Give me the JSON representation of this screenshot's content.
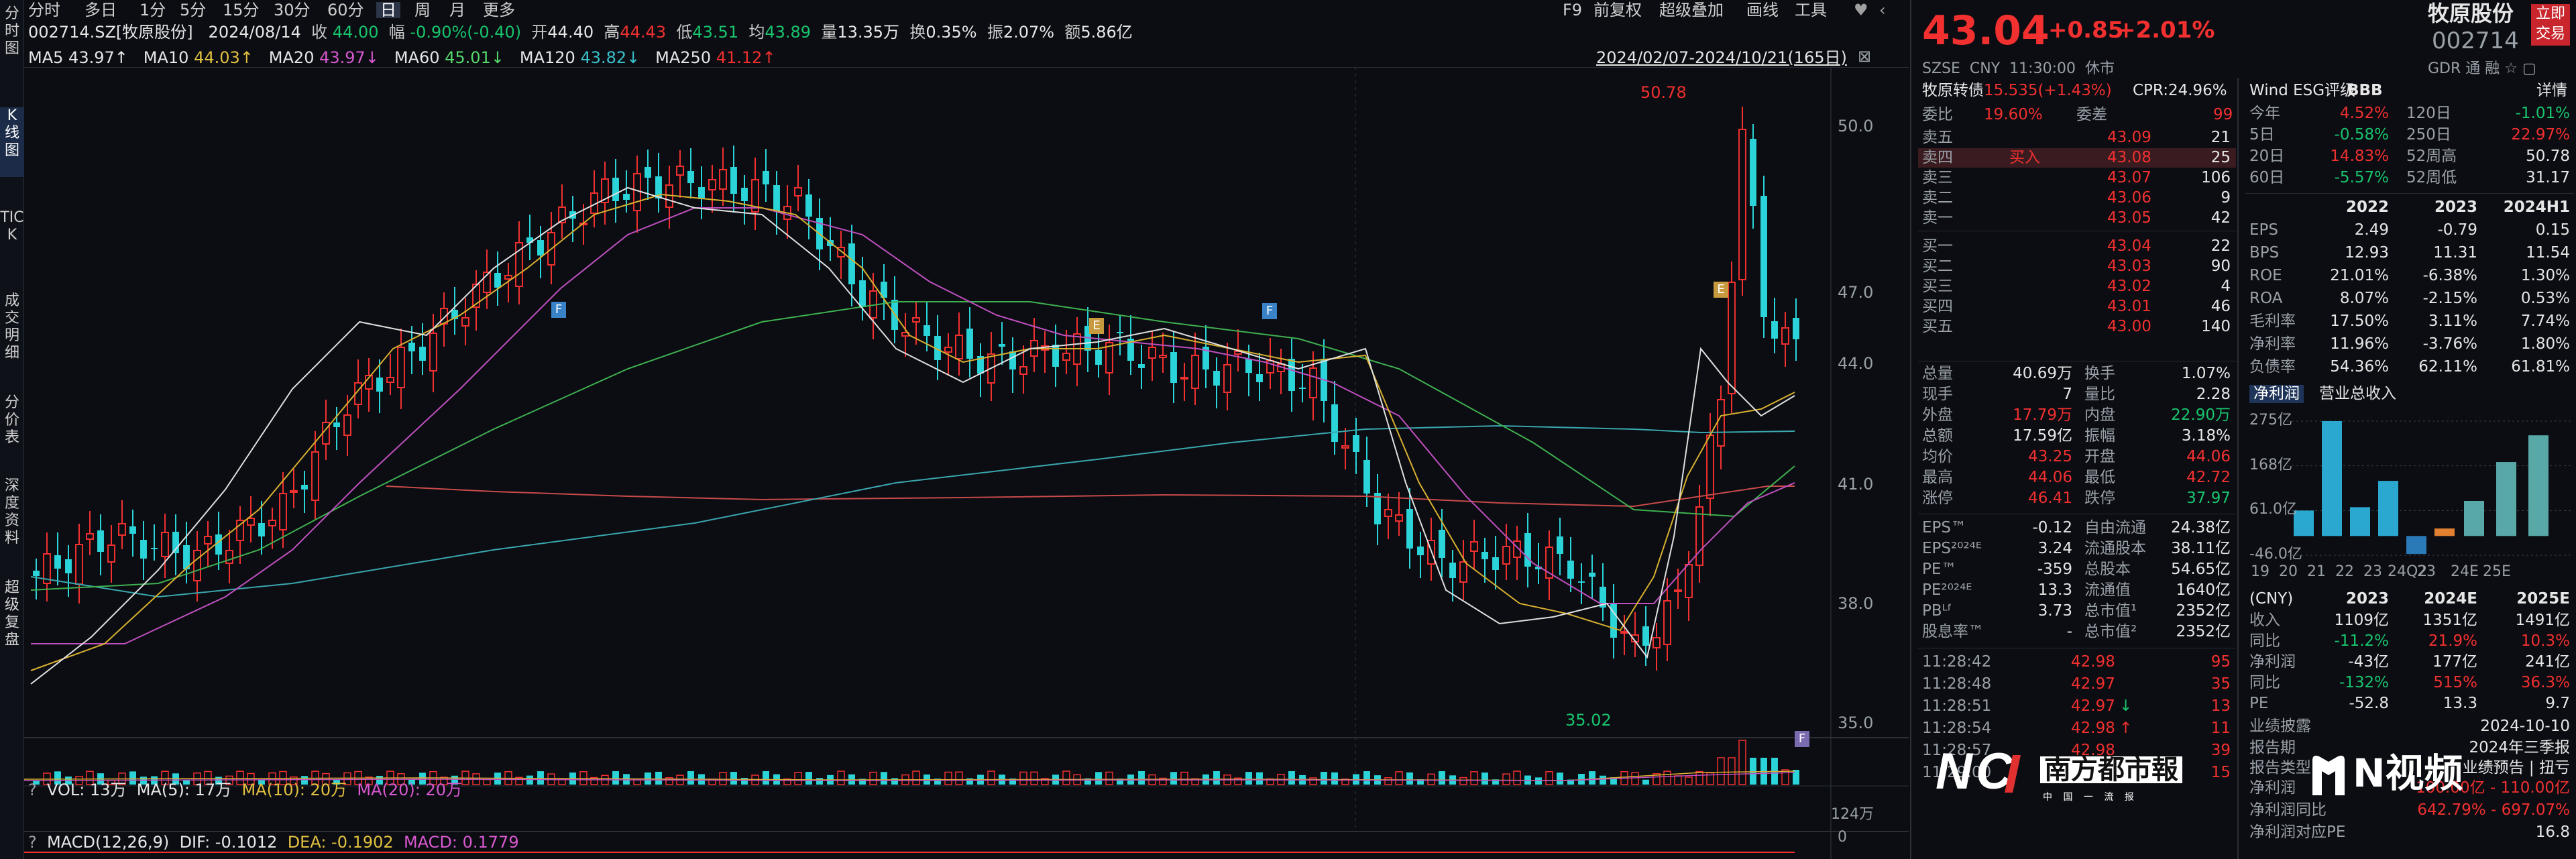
{
  "left_nav": [
    {
      "label": "分时图",
      "active": false
    },
    {
      "label": "K线图",
      "active": true
    },
    {
      "label": "TICK",
      "active": false
    },
    {
      "label": "成交明细",
      "active": false
    },
    {
      "label": "分价表",
      "active": false
    },
    {
      "label": "深度资料",
      "active": false
    },
    {
      "label": "超级复盘",
      "active": false
    }
  ],
  "toolbar": {
    "periods": [
      "分时",
      "多日",
      "1分",
      "5分",
      "15分",
      "30分",
      "60分",
      "日",
      "周",
      "月",
      "更多"
    ],
    "selected": "日",
    "right": [
      "F9",
      "前复权",
      "超级叠加",
      "画线",
      "工具"
    ],
    "heart": "♥",
    "more": "‹"
  },
  "info": {
    "code": "002714.SZ[牧原股份]",
    "date": "2024/08/14",
    "close_label": "收",
    "close": "44.00",
    "chg_label": "幅",
    "chg": "-0.90%(-0.40)",
    "open_label": "开",
    "open": "44.40",
    "high_label": "高",
    "high": "44.43",
    "low_label": "低",
    "low": "43.51",
    "avg_label": "均",
    "avg": "43.89",
    "vol_label": "量",
    "vol": "13.35万",
    "turn_label": "换",
    "turn": "0.35%",
    "amp_label": "振",
    "amp": "2.07%",
    "amt_label": "额",
    "amt": "5.86亿"
  },
  "ma": [
    {
      "label": "MA5",
      "value": "43.97↑",
      "color": "#e6e6e6"
    },
    {
      "label": "MA10",
      "value": "44.03↑",
      "color": "#e2c140"
    },
    {
      "label": "MA20",
      "value": "43.97↓",
      "color": "#d858d0"
    },
    {
      "label": "MA60",
      "value": "45.01↓",
      "color": "#56d86a"
    },
    {
      "label": "MA120",
      "value": "43.82↓",
      "color": "#39c2cc"
    },
    {
      "label": "MA250",
      "value": "41.12↑",
      "color": "#f23030"
    }
  ],
  "range": "2024/02/07-2024/10/21(165日)",
  "price_axis": [
    "50.0",
    "47.0",
    "44.0",
    "41.0",
    "38.0",
    "35.0"
  ],
  "max_label": "50.78",
  "min_label": "35.02",
  "events": [
    "F",
    "E",
    "F",
    "E",
    "F"
  ],
  "vol_panel": {
    "help": "?",
    "label": "VOL: 13万",
    "ma5": "MA(5): 17万",
    "ma10": "MA(10): 20万",
    "ma20": "MA(20): 20万",
    "axis_top": "124万",
    "axis_bot": "0"
  },
  "macd_panel": {
    "help": "?",
    "label": "MACD(12,26,9)",
    "dif": "DIF: -0.1012",
    "dea": "DEA: -0.1902",
    "macd": "MACD: 0.1779"
  },
  "quote": {
    "price": "43.04",
    "change": "+0.85",
    "pct": "+2.01%",
    "name": "牧原股份",
    "code": "002714",
    "btn": "立即\n交易",
    "exchange": "SZSE",
    "currency": "CNY",
    "time": "11:30:00",
    "status": "休市",
    "gdr": "GDR 通 融 ☆ ▢"
  },
  "conv": {
    "label": "牧原转债",
    "value": "15.535(+1.43%)",
    "cpr": "CPR:24.96%"
  },
  "order_ratio": {
    "l1": "委比",
    "v1": "19.60%",
    "l2": "委差",
    "v2": "99"
  },
  "asks": [
    {
      "label": "卖五",
      "price": "43.09",
      "vol": "21"
    },
    {
      "label": "卖四",
      "price": "43.08",
      "vol": "25",
      "tag": "买入"
    },
    {
      "label": "卖三",
      "price": "43.07",
      "vol": "106"
    },
    {
      "label": "卖二",
      "price": "43.06",
      "vol": "9"
    },
    {
      "label": "卖一",
      "price": "43.05",
      "vol": "42"
    }
  ],
  "bids": [
    {
      "label": "买一",
      "price": "43.04",
      "vol": "22"
    },
    {
      "label": "买二",
      "price": "43.03",
      "vol": "90"
    },
    {
      "label": "买三",
      "price": "43.02",
      "vol": "4"
    },
    {
      "label": "买四",
      "price": "43.01",
      "vol": "46"
    },
    {
      "label": "买五",
      "price": "43.00",
      "vol": "140"
    }
  ],
  "stats": [
    [
      "总量",
      "40.69万",
      "换手",
      "1.07%"
    ],
    [
      "现手",
      "7",
      "量比",
      "2.28"
    ],
    [
      "外盘",
      "17.79万",
      "内盘",
      "22.90万"
    ],
    [
      "总额",
      "17.59亿",
      "振幅",
      "3.18%"
    ],
    [
      "均价",
      "43.25",
      "开盘",
      "44.06"
    ],
    [
      "最高",
      "44.06",
      "最低",
      "42.72"
    ],
    [
      "涨停",
      "46.41",
      "跌停",
      "37.97"
    ]
  ],
  "fund": [
    [
      "EPS™",
      "-0.12",
      "自由流通",
      "24.38亿"
    ],
    [
      "EPS²⁰²⁴ᴱ",
      "3.24",
      "流通股本",
      "38.11亿"
    ],
    [
      "PE™",
      "-359",
      "总股本",
      "54.65亿"
    ],
    [
      "PE²⁰²⁴ᴱ",
      "13.3",
      "流通值",
      "1640亿"
    ],
    [
      "PBᴸᶠ",
      "3.73",
      "总市值¹",
      "2352亿"
    ],
    [
      "股息率™",
      "-",
      "总市值²",
      "2352亿"
    ]
  ],
  "ticks": [
    [
      "11:28:42",
      "42.98",
      "95"
    ],
    [
      "11:28:48",
      "42.97",
      "35"
    ],
    [
      "11:28:51",
      "42.97",
      "13"
    ],
    [
      "11:28:54",
      "42.98",
      "11"
    ],
    [
      "11:28:57",
      "42.98",
      "39"
    ],
    [
      "11:29:00",
      "42.98",
      "15"
    ]
  ],
  "esg": {
    "label": "Wind ESG评级",
    "rating": "BBB",
    "detail": "详情"
  },
  "perf": [
    [
      "今年",
      "4.52%",
      "120日",
      "-1.01%"
    ],
    [
      "5日",
      "-0.58%",
      "250日",
      "22.97%"
    ],
    [
      "20日",
      "14.83%",
      "52周高",
      "50.78"
    ],
    [
      "60日",
      "-5.57%",
      "52周低",
      "31.17"
    ]
  ],
  "fin_years": [
    "2022",
    "2023",
    "2024H1"
  ],
  "fin": [
    [
      "EPS",
      "2.49",
      "-0.79",
      "0.15"
    ],
    [
      "BPS",
      "12.93",
      "11.31",
      "11.54"
    ],
    [
      "ROE",
      "21.01%",
      "-6.38%",
      "1.30%"
    ],
    [
      "ROA",
      "8.07%",
      "-2.15%",
      "0.53%"
    ],
    [
      "毛利率",
      "17.50%",
      "3.11%",
      "7.74%"
    ],
    [
      "净利率",
      "11.96%",
      "-3.76%",
      "1.80%"
    ],
    [
      "负债率",
      "54.36%",
      "62.11%",
      "61.81%"
    ]
  ],
  "fin_tabs": [
    "净利润",
    "营业总收入"
  ],
  "profit_chart": {
    "y_labels": [
      "275亿",
      "168亿",
      "61.0亿",
      "-46.0亿"
    ],
    "x_labels": [
      "19",
      "20",
      "21",
      "22",
      "23",
      "24Q2",
      "23",
      "24E",
      "25E"
    ]
  },
  "chart_data": {
    "type": "bar",
    "categories": [
      "19",
      "20",
      "21",
      "22",
      "23",
      "24Q2",
      "23",
      "24E",
      "25E"
    ],
    "values": [
      61,
      275,
      69,
      132,
      -43,
      18,
      84,
      177,
      241
    ],
    "ylim": [
      -46,
      275
    ]
  },
  "forecast": {
    "header": [
      "(CNY)",
      "2023",
      "2024E",
      "2025E"
    ],
    "rows": [
      [
        "收入",
        "1109亿",
        "1351亿",
        "1491亿"
      ],
      [
        "同比",
        "-11.2%",
        "21.9%",
        "10.3%"
      ],
      [
        "净利润",
        "-43亿",
        "177亿",
        "241亿"
      ],
      [
        "同比",
        "-132%",
        "515%",
        "36.3%"
      ],
      [
        "PE",
        "-52.8",
        "13.3",
        "9.7"
      ]
    ]
  },
  "report": {
    "l1": "业绩披露",
    "d1": "2024-10-10",
    "l2": "报告期",
    "d2": "2024年三季报",
    "l3": "报告类型",
    "d3": "业绩预告 | 扭亏",
    "rows": [
      [
        "净利润",
        "100.00亿 - 110.00亿"
      ],
      [
        "净利润同比",
        "642.79% - 697.07%"
      ],
      [
        "净利润对应PE",
        "16.8"
      ]
    ]
  },
  "watermarks": {
    "nandu": "南方都市報",
    "nandu_sub": "中 国 一 流 报",
    "nvideo": "N视频"
  }
}
